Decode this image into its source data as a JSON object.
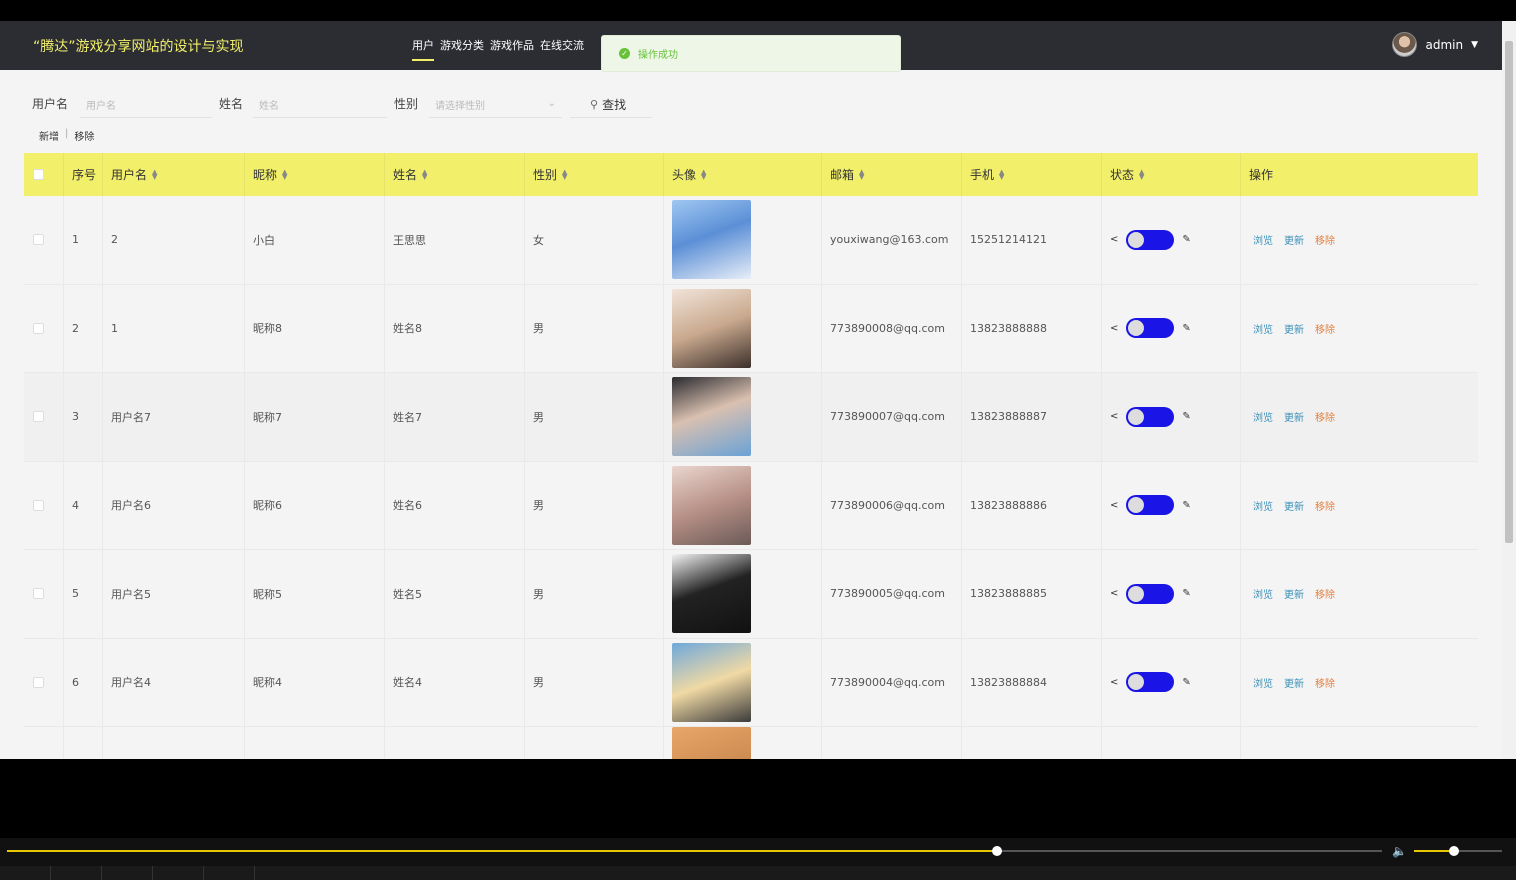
{
  "header": {
    "title": "“腾达”游戏分享网站的设计与实现",
    "nav": [
      {
        "label": "用户",
        "active": true
      },
      {
        "label": "游戏分类",
        "active": false
      },
      {
        "label": "游戏作品",
        "active": false
      },
      {
        "label": "在线交流",
        "active": false
      }
    ],
    "user": "admin"
  },
  "toast": {
    "text": "操作成功",
    "color": "#67c23a"
  },
  "search": {
    "username_label": "用户名",
    "username_placeholder": "用户名",
    "name_label": "姓名",
    "name_placeholder": "姓名",
    "gender_label": "性别",
    "gender_placeholder": "请选择性别",
    "search_label": "查找"
  },
  "tools": {
    "add_label": "新增",
    "remove_label": "移除"
  },
  "table": {
    "headers": {
      "index": "序号",
      "username": "用户名",
      "nickname": "昵称",
      "name": "姓名",
      "gender": "性别",
      "avatar": "头像",
      "email": "邮箱",
      "phone": "手机",
      "status": "状态",
      "actions": "操作"
    },
    "rows": [
      {
        "index": "1",
        "username": "2",
        "nickname": "小白",
        "name": "王思思",
        "gender": "女",
        "email": "youxiwang@163.com",
        "phone": "15251214121"
      },
      {
        "index": "2",
        "username": "1",
        "nickname": "昵称8",
        "name": "姓名8",
        "gender": "男",
        "email": "773890008@qq.com",
        "phone": "13823888888"
      },
      {
        "index": "3",
        "username": "用户名7",
        "nickname": "昵称7",
        "name": "姓名7",
        "gender": "男",
        "email": "773890007@qq.com",
        "phone": "13823888887"
      },
      {
        "index": "4",
        "username": "用户名6",
        "nickname": "昵称6",
        "name": "姓名6",
        "gender": "男",
        "email": "773890006@qq.com",
        "phone": "13823888886"
      },
      {
        "index": "5",
        "username": "用户名5",
        "nickname": "昵称5",
        "name": "姓名5",
        "gender": "男",
        "email": "773890005@qq.com",
        "phone": "13823888885"
      },
      {
        "index": "6",
        "username": "用户名4",
        "nickname": "昵称4",
        "name": "姓名4",
        "gender": "男",
        "email": "773890004@qq.com",
        "phone": "13823888884"
      }
    ],
    "row_actions": {
      "view": "浏览",
      "update": "更新",
      "delete": "移除"
    },
    "header_color": "#f2ef6a",
    "toggle_color": "#1a14e6"
  },
  "player": {
    "progress": 0.72,
    "volume": 0.45
  }
}
